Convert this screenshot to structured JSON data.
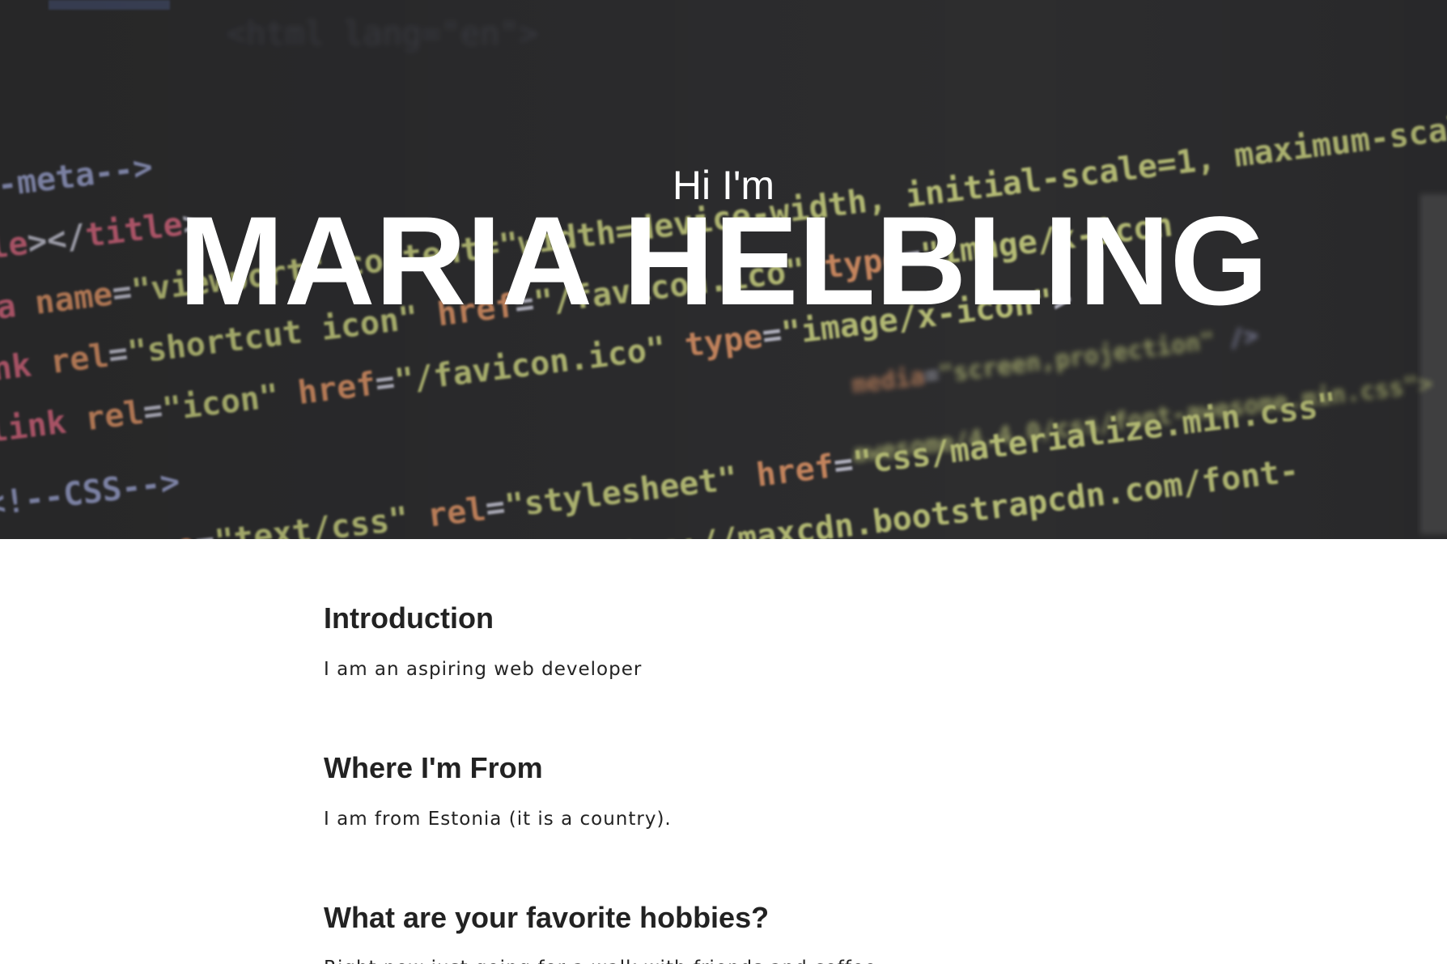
{
  "hero": {
    "greeting": "Hi I'm",
    "name": "MARIA HELBLING",
    "background_code_lines": [
      "<!--meta-->",
      "<title></title>",
      "<meta name=\"viewport\" content=\"width=device-width, initial-scale=1, maximum-scale=1, user-scalable=no\">",
      "<link rel=\"shortcut icon\" href=\"/favicon.ico\" type=\"image/x-icon\">",
      "<link rel=\"icon\" href=\"/favicon.ico\" type=\"image/x-icon\">",
      "<!--CSS-->",
      "<link type=\"text/css\" rel=\"stylesheet\" href=\"css/materialize.min.css\" media=\"screen,projection\" />",
      "<link rel=\"stylesheet\" href=\"https://maxcdn.bootstrapcdn.com/font-awesome/4.4.0/css/font-awesome.min.css\">"
    ]
  },
  "sections": [
    {
      "heading": "Introduction",
      "body": "I am an aspiring web developer"
    },
    {
      "heading": "Where I'm From",
      "body": "I am from Estonia (it is a country)."
    },
    {
      "heading": "What are your favorite hobbies?",
      "body": "Right now just going for a walk with friends and coffee..."
    }
  ],
  "colors": {
    "hero_bg": "#2f2f31",
    "hero_text": "#ffffff",
    "body_text": "#222222",
    "code_tag": "#e8708a",
    "code_attr": "#f0a070",
    "code_string": "#d8e08a",
    "code_comment": "#a8b0e0"
  }
}
